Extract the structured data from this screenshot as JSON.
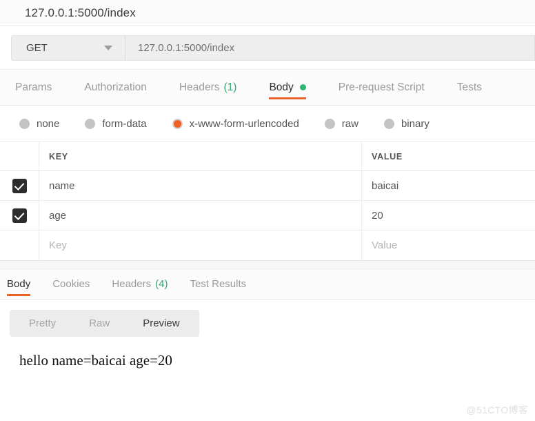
{
  "window": {
    "title": "127.0.0.1:5000/index"
  },
  "request": {
    "method": "GET",
    "method_caret": "chevron-down-icon",
    "url": "127.0.0.1:5000/index",
    "tabs": [
      {
        "label": "Params",
        "count": "",
        "active": false
      },
      {
        "label": "Authorization",
        "count": "",
        "active": false
      },
      {
        "label": "Headers",
        "count": "(1)",
        "active": false
      },
      {
        "label": "Body",
        "count": "",
        "active": true,
        "dot": true
      },
      {
        "label": "Pre-request Script",
        "count": "",
        "active": false
      },
      {
        "label": "Tests",
        "count": "",
        "active": false
      }
    ],
    "body_types": [
      {
        "label": "none",
        "selected": false
      },
      {
        "label": "form-data",
        "selected": false
      },
      {
        "label": "x-www-form-urlencoded",
        "selected": true
      },
      {
        "label": "raw",
        "selected": false
      },
      {
        "label": "binary",
        "selected": false
      }
    ],
    "table": {
      "headers": {
        "key": "KEY",
        "value": "VALUE"
      },
      "rows": [
        {
          "checked": true,
          "key": "name",
          "value": "baicai",
          "placeholder": false
        },
        {
          "checked": true,
          "key": "age",
          "value": "20",
          "placeholder": false
        },
        {
          "checked": false,
          "key": "Key",
          "value": "Value",
          "placeholder": true
        }
      ]
    }
  },
  "response": {
    "tabs": [
      {
        "label": "Body",
        "count": "",
        "active": true
      },
      {
        "label": "Cookies",
        "count": "",
        "active": false
      },
      {
        "label": "Headers",
        "count": "(4)",
        "active": false
      },
      {
        "label": "Test Results",
        "count": "",
        "active": false
      }
    ],
    "view_modes": [
      {
        "label": "Pretty",
        "active": false
      },
      {
        "label": "Raw",
        "active": false
      },
      {
        "label": "Preview",
        "active": true
      }
    ],
    "body_text": "hello name=baicai age=20"
  },
  "watermark": "@51CTO博客",
  "colors": {
    "accent_orange": "#e8622c",
    "status_green": "#2eaa6e",
    "radio_selected": "#ee6123",
    "checkbox_dark": "#2c2c2c"
  }
}
